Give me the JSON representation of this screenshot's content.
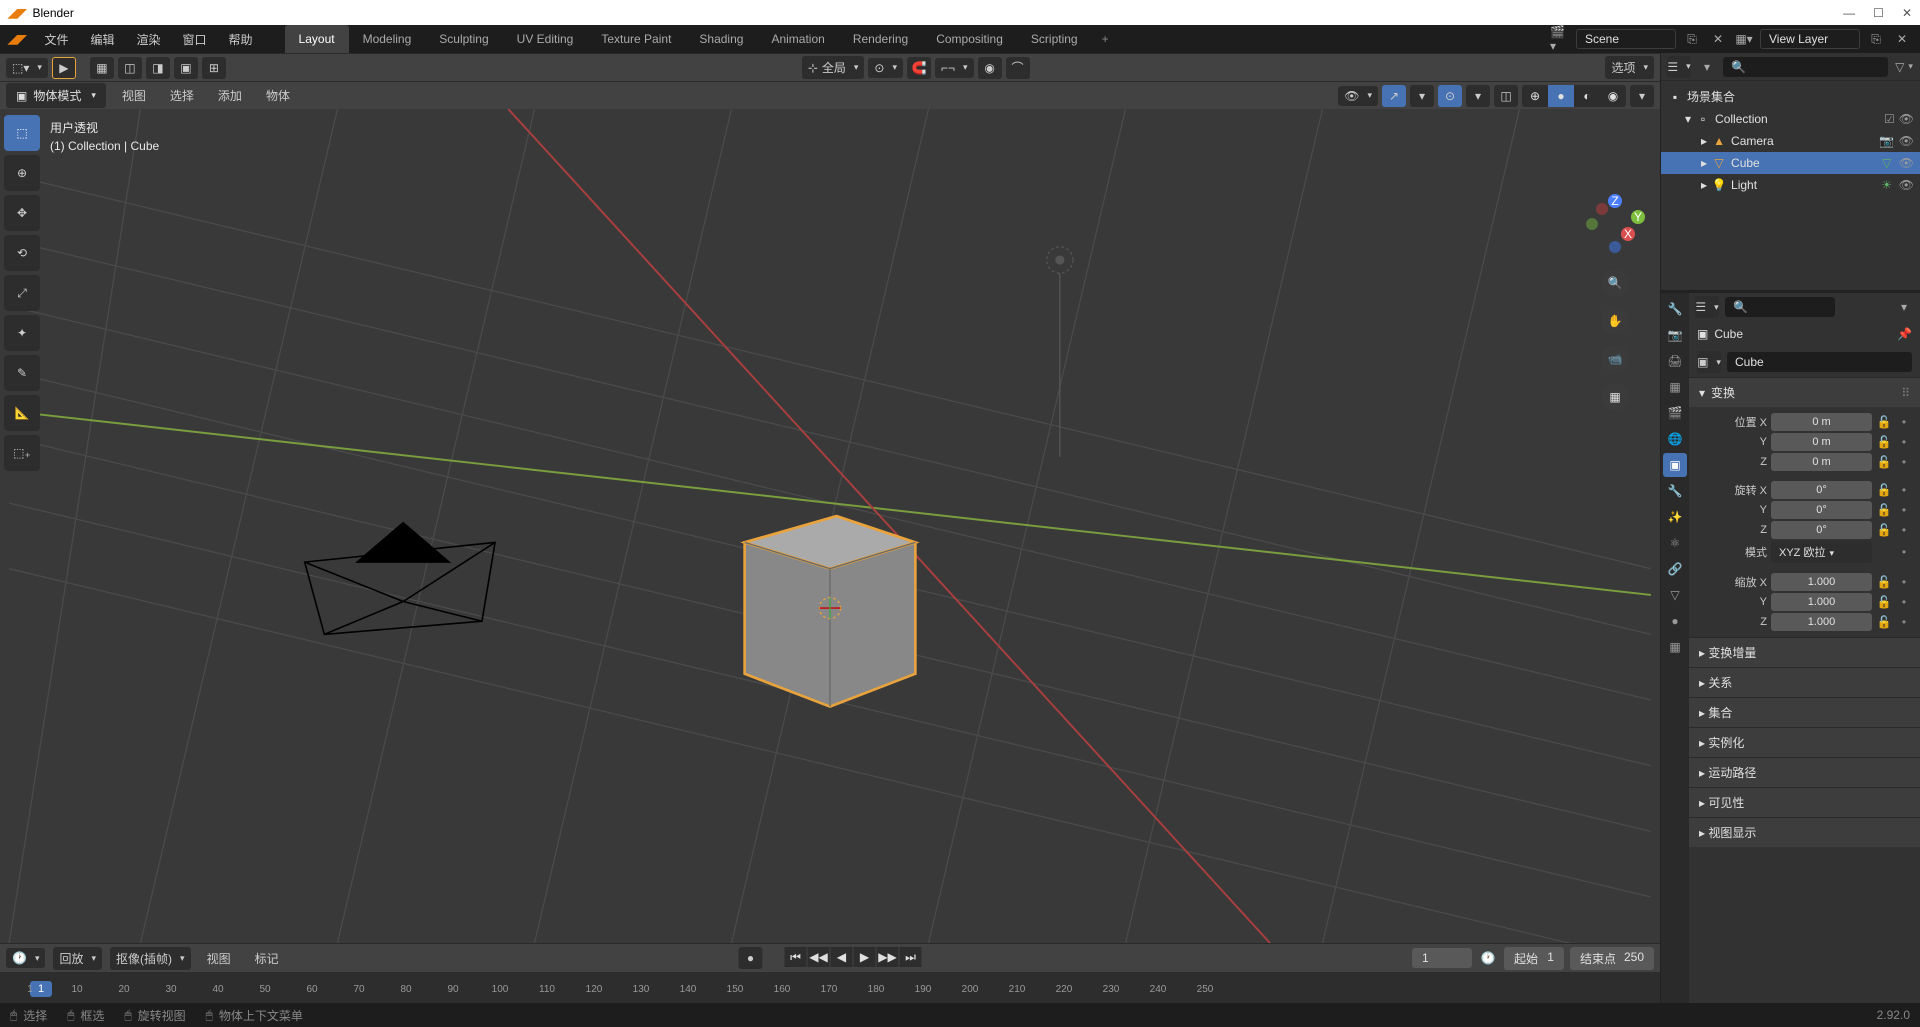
{
  "app": {
    "title": "Blender"
  },
  "menubar": [
    "文件",
    "编辑",
    "渲染",
    "窗口",
    "帮助"
  ],
  "workspaces": {
    "tabs": [
      "Layout",
      "Modeling",
      "Sculpting",
      "UV Editing",
      "Texture Paint",
      "Shading",
      "Animation",
      "Rendering",
      "Compositing",
      "Scripting"
    ],
    "active": "Layout",
    "add": "+"
  },
  "scene": {
    "name": "Scene",
    "view_layer": "View Layer"
  },
  "viewport": {
    "pivot": "全局",
    "options": "选项",
    "mode": "物体模式",
    "mode_menus": [
      "视图",
      "选择",
      "添加",
      "物体"
    ],
    "overlay_title": "用户透视",
    "overlay_path": "(1) Collection | Cube",
    "axes": {
      "x": "X",
      "y": "Y",
      "z": "Z"
    }
  },
  "timeline": {
    "playback": "回放",
    "keying": "抠像(插帧)",
    "menus": [
      "视图",
      "标记"
    ],
    "current_frame": "1",
    "start_label": "起始",
    "start": "1",
    "end_label": "结束点",
    "end": "250",
    "frames": [
      "1",
      "10",
      "20",
      "30",
      "40",
      "50",
      "60",
      "70",
      "80",
      "90",
      "100",
      "110",
      "120",
      "130",
      "140",
      "150",
      "160",
      "170",
      "180",
      "190",
      "200",
      "210",
      "220",
      "230",
      "240",
      "250"
    ]
  },
  "outliner": {
    "root": "场景集合",
    "collection": "Collection",
    "items": [
      {
        "name": "Camera",
        "icon": "📷",
        "color": "#e8a33d"
      },
      {
        "name": "Cube",
        "icon": "▽",
        "color": "#e8a33d",
        "selected": true
      },
      {
        "name": "Light",
        "icon": "💡",
        "color": "#e8a33d"
      }
    ]
  },
  "properties": {
    "object_name": "Cube",
    "data_name": "Cube",
    "panels": {
      "transform": {
        "title": "变换",
        "position": {
          "label": "位置 X",
          "x": "0 m",
          "y": "0 m",
          "z": "0 m"
        },
        "rotation": {
          "label": "旋转 X",
          "x": "0°",
          "y": "0°",
          "z": "0°"
        },
        "mode_label": "模式",
        "mode_value": "XYZ 欧拉",
        "scale": {
          "label": "缩放 X",
          "x": "1.000",
          "y": "1.000",
          "z": "1.000"
        }
      },
      "collapsed": [
        "变换增量",
        "关系",
        "集合",
        "实例化",
        "运动路径",
        "可见性",
        "视图显示"
      ]
    }
  },
  "statusbar": {
    "select": "选择",
    "box_select": "框选",
    "rotate_view": "旋转视图",
    "context_menu": "物体上下文菜单",
    "version": "2.92.0"
  },
  "axis_y_label": "Y",
  "axis_z_label": "Z"
}
